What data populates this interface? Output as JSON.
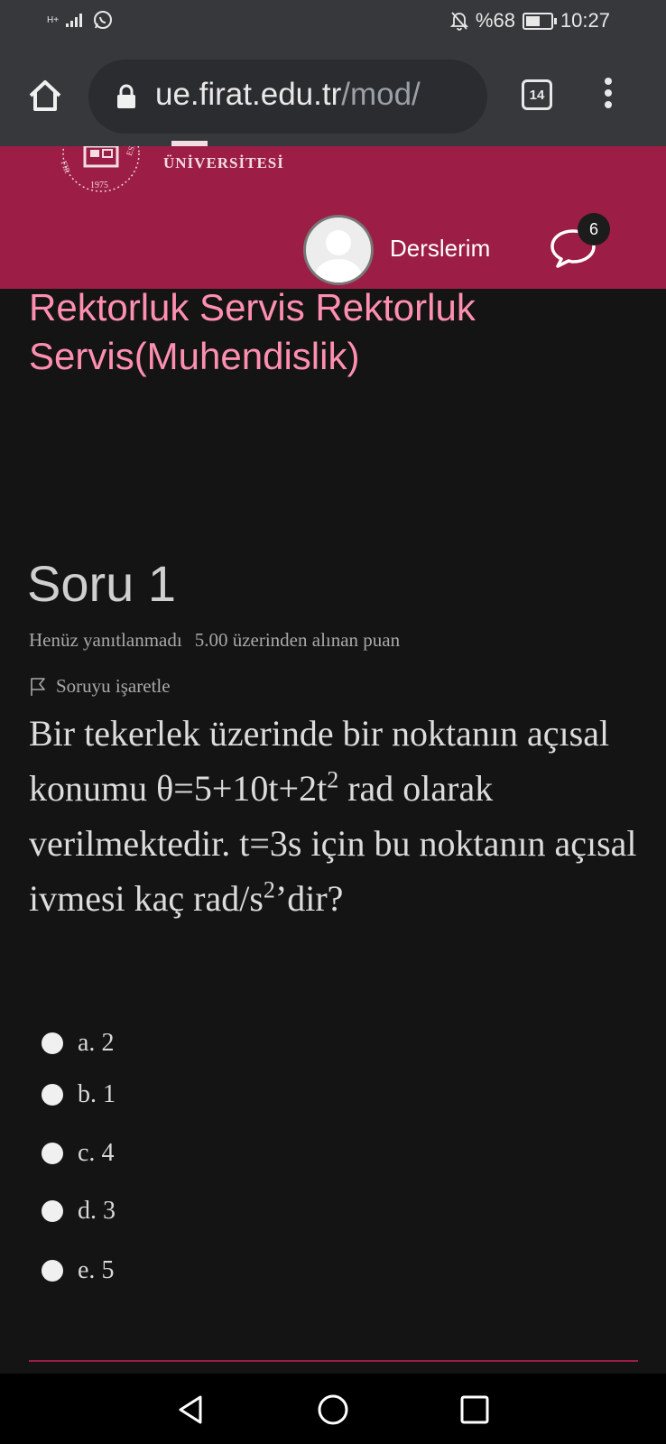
{
  "status_bar": {
    "network": "H+",
    "mute_icon": "bell-off-icon",
    "battery": "%68",
    "battery_level": 0.68,
    "time": "10:27"
  },
  "browser": {
    "url_host": "ue.firat.edu.tr",
    "url_path": "/mod/",
    "tab_count": "14"
  },
  "site_header": {
    "university": "ÜNİVERSİTESİ",
    "seal_year": "1975",
    "nav_label": "Derslerim",
    "message_count": "6",
    "brand_color": "#9c1d45"
  },
  "course_title": "Rektorluk Servis Rektorluk Servis(Muhendislik)",
  "question": {
    "heading": "Soru 1",
    "status": "Henüz yanıtlanmadı",
    "grade": "5.00 üzerinden alınan puan",
    "flag_label": "Soruyu işaretle",
    "text_part1": "Bir tekerlek üzerinde bir noktanın açısal konumu θ=5+10t+2t",
    "sup1": "2",
    "text_part2": " rad olarak verilmektedir. t=3s için bu noktanın açısal ivmesi kaç rad/s",
    "sup2": "2",
    "text_part3": "’dir?",
    "options": [
      {
        "letter": "a.",
        "value": "2"
      },
      {
        "letter": "b.",
        "value": "1"
      },
      {
        "letter": "c.",
        "value": "4"
      },
      {
        "letter": "d.",
        "value": "3"
      },
      {
        "letter": "e.",
        "value": "5"
      }
    ]
  }
}
